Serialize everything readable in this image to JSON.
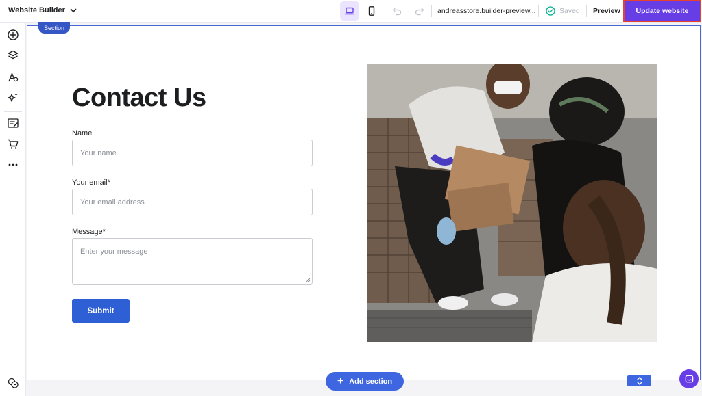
{
  "topbar": {
    "app_title": "Website Builder",
    "site_url": "andreasstore.builder-preview...",
    "saved_label": "Saved",
    "preview_label": "Preview",
    "update_label": "Update website"
  },
  "sidebar": {
    "items": [
      {
        "name": "add-element-icon"
      },
      {
        "name": "layers-icon"
      },
      {
        "name": "styles-icon"
      },
      {
        "name": "ai-tools-icon"
      },
      {
        "name": "blog-icon"
      },
      {
        "name": "store-icon"
      },
      {
        "name": "more-icon"
      }
    ]
  },
  "section": {
    "tag": "Section",
    "heading": "Contact Us",
    "form": {
      "name_label": "Name",
      "name_placeholder": "Your name",
      "email_label": "Your email*",
      "email_placeholder": "Your email address",
      "message_label": "Message*",
      "message_placeholder": "Enter your message",
      "submit_label": "Submit"
    },
    "image_alt": "Volunteers passing boxes"
  },
  "canvas": {
    "add_section_label": "Add section"
  },
  "colors": {
    "accent": "#673de6",
    "submit": "#2f5fd4",
    "section_outline": "#4a67d8",
    "highlight": "#e8412f"
  }
}
